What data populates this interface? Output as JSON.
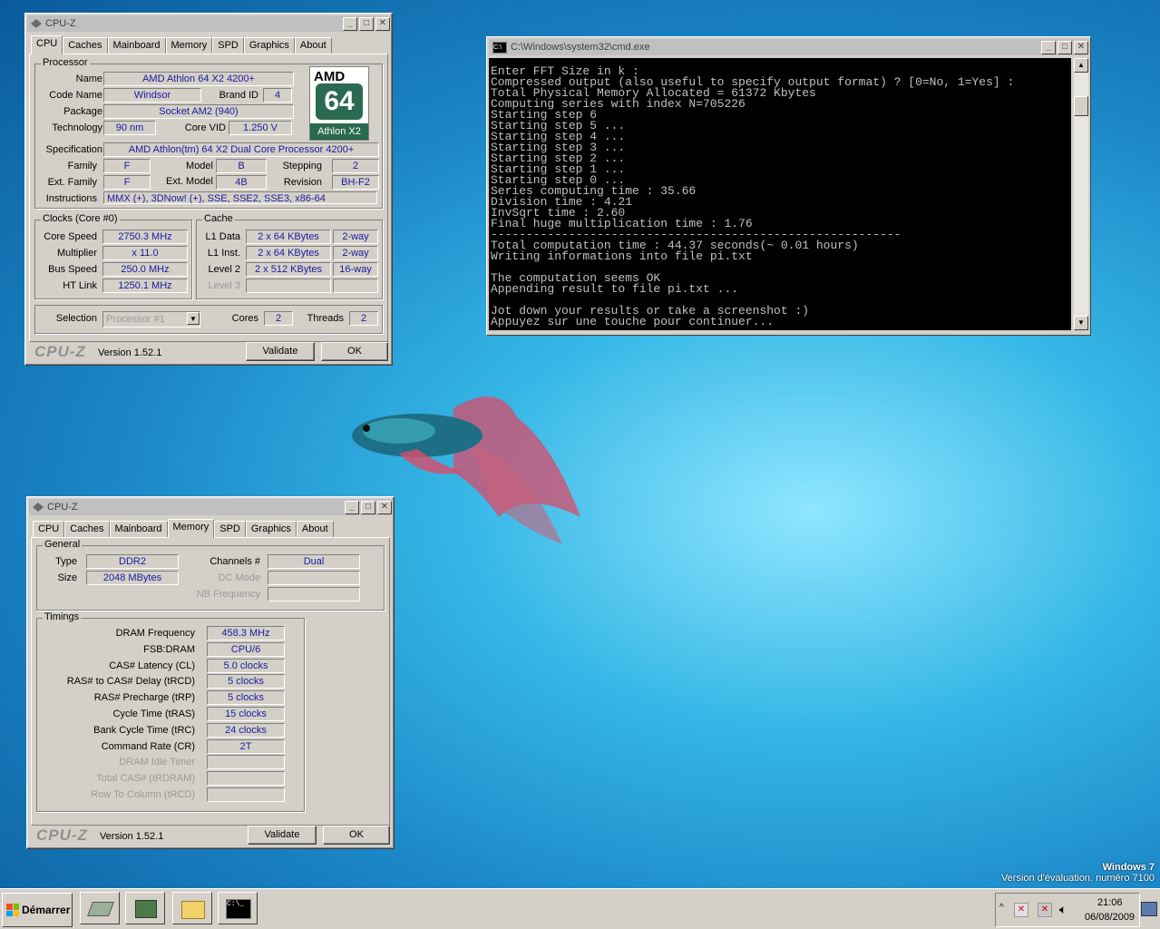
{
  "cpuz1": {
    "title": "CPU-Z",
    "tabs": [
      "CPU",
      "Caches",
      "Mainboard",
      "Memory",
      "SPD",
      "Graphics",
      "About"
    ],
    "active_tab": "CPU",
    "processor": {
      "group": "Processor",
      "name_label": "Name",
      "name": "AMD Athlon 64 X2 4200+",
      "codename_label": "Code Name",
      "codename": "Windsor",
      "brandid_label": "Brand ID",
      "brandid": "4",
      "package_label": "Package",
      "package": "Socket AM2 (940)",
      "technology_label": "Technology",
      "technology": "90 nm",
      "corevid_label": "Core VID",
      "corevid": "1.250 V",
      "spec_label": "Specification",
      "spec": "AMD Athlon(tm) 64 X2 Dual Core Processor 4200+",
      "family_label": "Family",
      "family": "F",
      "model_label": "Model",
      "model": "B",
      "stepping_label": "Stepping",
      "stepping": "2",
      "extfamily_label": "Ext. Family",
      "extfamily": "F",
      "extmodel_label": "Ext. Model",
      "extmodel": "4B",
      "revision_label": "Revision",
      "revision": "BH-F2",
      "instr_label": "Instructions",
      "instr": "MMX (+), 3DNow! (+), SSE, SSE2, SSE3, x86-64"
    },
    "logo": {
      "brand": "AMD",
      "num": "64",
      "product": "Athlon X2"
    },
    "clocks": {
      "group": "Clocks (Core #0)",
      "corespeed_label": "Core Speed",
      "corespeed": "2750.3 MHz",
      "multiplier_label": "Multiplier",
      "multiplier": "x 11.0",
      "busspeed_label": "Bus Speed",
      "busspeed": "250.0 MHz",
      "htlink_label": "HT Link",
      "htlink": "1250.1 MHz"
    },
    "cache": {
      "group": "Cache",
      "l1d_label": "L1 Data",
      "l1d": "2 x 64 KBytes",
      "l1d_way": "2-way",
      "l1i_label": "L1 Inst.",
      "l1i": "2 x 64 KBytes",
      "l1i_way": "2-way",
      "l2_label": "Level 2",
      "l2": "2 x 512 KBytes",
      "l2_way": "16-way",
      "l3_label": "Level 3"
    },
    "selection_label": "Selection",
    "selection": "Processor #1",
    "cores_label": "Cores",
    "cores": "2",
    "threads_label": "Threads",
    "threads": "2",
    "logo_text": "CPU-Z",
    "version": "Version 1.52.1",
    "validate": "Validate",
    "ok": "OK"
  },
  "cpuz2": {
    "title": "CPU-Z",
    "tabs": [
      "CPU",
      "Caches",
      "Mainboard",
      "Memory",
      "SPD",
      "Graphics",
      "About"
    ],
    "active_tab": "Memory",
    "general": {
      "group": "General",
      "type_label": "Type",
      "type": "DDR2",
      "size_label": "Size",
      "size": "2048 MBytes",
      "channels_label": "Channels #",
      "channels": "Dual",
      "dcmode_label": "DC Mode",
      "nbfreq_label": "NB Frequency"
    },
    "timings": {
      "group": "Timings",
      "rows": [
        {
          "label": "DRAM Frequency",
          "value": "458.3 MHz"
        },
        {
          "label": "FSB:DRAM",
          "value": "CPU/6"
        },
        {
          "label": "CAS# Latency (CL)",
          "value": "5.0 clocks"
        },
        {
          "label": "RAS# to CAS# Delay (tRCD)",
          "value": "5 clocks"
        },
        {
          "label": "RAS# Precharge (tRP)",
          "value": "5 clocks"
        },
        {
          "label": "Cycle Time (tRAS)",
          "value": "15 clocks"
        },
        {
          "label": "Bank Cycle Time (tRC)",
          "value": "24 clocks"
        },
        {
          "label": "Command Rate (CR)",
          "value": "2T"
        },
        {
          "label": "DRAM Idle Timer",
          "value": ""
        },
        {
          "label": "Total CAS# (tRDRAM)",
          "value": ""
        },
        {
          "label": "Row To Column (tRCD)",
          "value": ""
        }
      ]
    },
    "logo_text": "CPU-Z",
    "version": "Version 1.52.1",
    "validate": "Validate",
    "ok": "OK"
  },
  "cmd": {
    "title": "C:\\Windows\\system32\\cmd.exe",
    "lines": [
      "Enter FFT Size in k :",
      "Compressed output (also useful to specify output format) ? [0=No, 1=Yes] :",
      "Total Physical Memory Allocated = 61372 Kbytes",
      "Computing series with index N=705226",
      "Starting step 6",
      "Starting step 5 ...",
      "Starting step 4 ...",
      "Starting step 3 ...",
      "Starting step 2 ...",
      "Starting step 1 ...",
      "Starting step 0 ...",
      "Series computing time : 35.66",
      "Division time : 4.21",
      "InvSqrt time : 2.60",
      "Final huge multiplication time : 1.76",
      "----------------------------------------------------------",
      "Total computation time : 44.37 seconds(~ 0.01 hours)",
      "Writing informations into file pi.txt",
      "",
      "The computation seems OK",
      "Appending result to file pi.txt ...",
      "",
      "Jot down your results or take a screenshot :)",
      "Appuyez sur une touche pour continuer..."
    ]
  },
  "watermark": {
    "line1": "Windows 7",
    "line2": "Version d'évaluation. numéro 7100"
  },
  "taskbar": {
    "start": "Démarrer",
    "time": "21:06",
    "date": "06/08/2009",
    "cmd_icon": "C:\\_"
  },
  "colors": {
    "value_text": "#1a1aa0",
    "window_bg": "#d4d0c8",
    "console_bg": "#000000",
    "console_fg": "#c0c0c0"
  }
}
